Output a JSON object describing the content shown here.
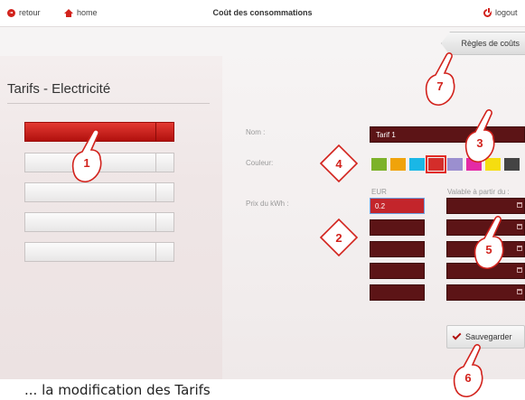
{
  "topbar": {
    "back_label": "retour",
    "home_label": "home",
    "title": "Coût des consommations",
    "logout_label": "logout"
  },
  "rules_button": "Règles de coûts",
  "section_title": "Tarifs - Electricité",
  "tariffs": [
    "",
    "",
    "",
    "",
    ""
  ],
  "form": {
    "name_label": "Nom :",
    "name_value": "Tarif 1",
    "color_label": "Couleur:",
    "price_label": "Prix du kWh :",
    "currency_header": "EUR",
    "valid_from_header": "Valable à partir du :",
    "price_values": [
      "0.2",
      "",
      "",
      "",
      ""
    ],
    "date_values": [
      "",
      "",
      "",
      "",
      ""
    ]
  },
  "colors": [
    "#7cb22a",
    "#f0a30a",
    "#1ab7e6",
    "#d42d2a",
    "#9b8fcf",
    "#e42aa6",
    "#f5dd10",
    "#444444"
  ],
  "selected_color_index": 3,
  "save_label": "Sauvegarder",
  "callouts": [
    "1",
    "2",
    "3",
    "4",
    "5",
    "6",
    "7"
  ],
  "caption": "... la modification des Tarifs"
}
